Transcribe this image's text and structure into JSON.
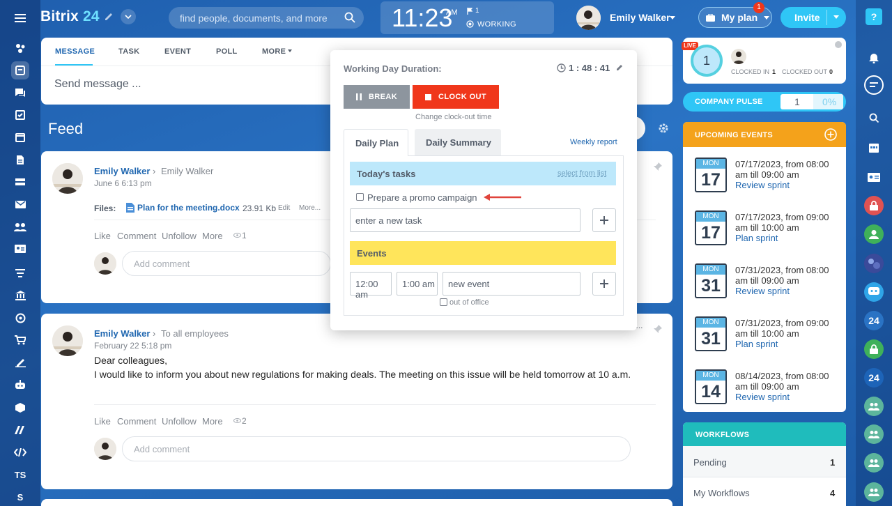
{
  "header": {
    "logo": "Bitrix",
    "logo_num": "24",
    "search_placeholder": "find people, documents, and more",
    "time": "11:23",
    "ampm": "AM",
    "flag_count": "1",
    "work_status": "WORKING",
    "user_name": "Emily Walker",
    "myplan_label": "My plan",
    "myplan_badge": "1",
    "invite_label": "Invite"
  },
  "left_rail": {
    "text_items": [
      "TS",
      "S"
    ]
  },
  "composer": {
    "tabs": [
      "MESSAGE",
      "TASK",
      "EVENT",
      "POLL",
      "MORE"
    ],
    "placeholder": "Send message ..."
  },
  "feed": {
    "title": "Feed",
    "posts": [
      {
        "author": "Emily Walker",
        "target": "Emily Walker",
        "date": "June 6 6:13 pm",
        "files_label": "Files:",
        "file_name": "Plan for the meeting.docx",
        "file_size": "23.91 Kb",
        "file_edit": "Edit",
        "file_more": "More...",
        "actions": [
          "Like",
          "Comment",
          "Unfollow",
          "More"
        ],
        "views": "1",
        "comment_placeholder": "Add comment"
      },
      {
        "author": "Emily Walker",
        "target": "To all employees",
        "date": "February 22 5:18 pm",
        "body1": "Dear colleagues,",
        "body2": "I would like to inform you about new regulations for making deals. The meeting on this issue will be held tomorrow at 10 a.m.",
        "actions": [
          "Like",
          "Comment",
          "Unfollow",
          "More"
        ],
        "views": "2",
        "comment_placeholder": "Add comment"
      }
    ]
  },
  "popup": {
    "duration_label": "Working Day Duration:",
    "duration_value": "1 : 48 : 41",
    "break_label": "BREAK",
    "clockout_label": "CLOCK OUT",
    "change_clockout": "Change clock-out time",
    "tabs": [
      "Daily Plan",
      "Daily Summary"
    ],
    "weekly_report": "Weekly report",
    "tasks_title": "Today's tasks",
    "select_from_list": "select from list",
    "task_item": "Prepare a promo campaign",
    "new_task_placeholder": "enter a new task",
    "events_title": "Events",
    "event_start": "12:00 am",
    "event_duration": "1:00 am",
    "event_name": "new event",
    "out_of_office": "out of office"
  },
  "right": {
    "live_badge": "LIVE",
    "gauge_value": "1",
    "clocked_in_label": "CLOCKED IN",
    "clocked_in": "1",
    "clocked_out_label": "CLOCKED OUT",
    "clocked_out": "0",
    "pulse_label": "COMPANY PULSE",
    "pulse_value": "1",
    "pulse_percent": "0%",
    "events_title": "UPCOMING EVENTS",
    "events": [
      {
        "month": "MON",
        "day": "17",
        "line1": "07/17/2023, from 08:00",
        "line2": "am till 09:00 am",
        "name": "Review sprint"
      },
      {
        "month": "MON",
        "day": "17",
        "line1": "07/17/2023, from 09:00",
        "line2": "am till 10:00 am",
        "name": "Plan sprint"
      },
      {
        "month": "MON",
        "day": "31",
        "line1": "07/31/2023, from 08:00",
        "line2": "am till 09:00 am",
        "name": "Review sprint"
      },
      {
        "month": "MON",
        "day": "31",
        "line1": "07/31/2023, from 09:00",
        "line2": "am till 10:00 am",
        "name": "Plan sprint"
      },
      {
        "month": "MON",
        "day": "14",
        "line1": "08/14/2023, from 08:00",
        "line2": "am till 09:00 am",
        "name": "Review sprint"
      }
    ],
    "workflows_title": "WORKFLOWS",
    "workflows": [
      {
        "label": "Pending",
        "count": "1"
      },
      {
        "label": "My Workflows",
        "count": "4"
      }
    ]
  },
  "right_rail": {
    "badge_24": "24"
  },
  "colors": {
    "accent_blue": "#2fc6f6",
    "clockout_red": "#f0371b",
    "break_gray": "#8d959e",
    "events_orange": "#f4a21b",
    "workflows_teal": "#1fbcbc",
    "events_yellow": "#ffe55b",
    "tasks_blue": "#bde8fb"
  }
}
